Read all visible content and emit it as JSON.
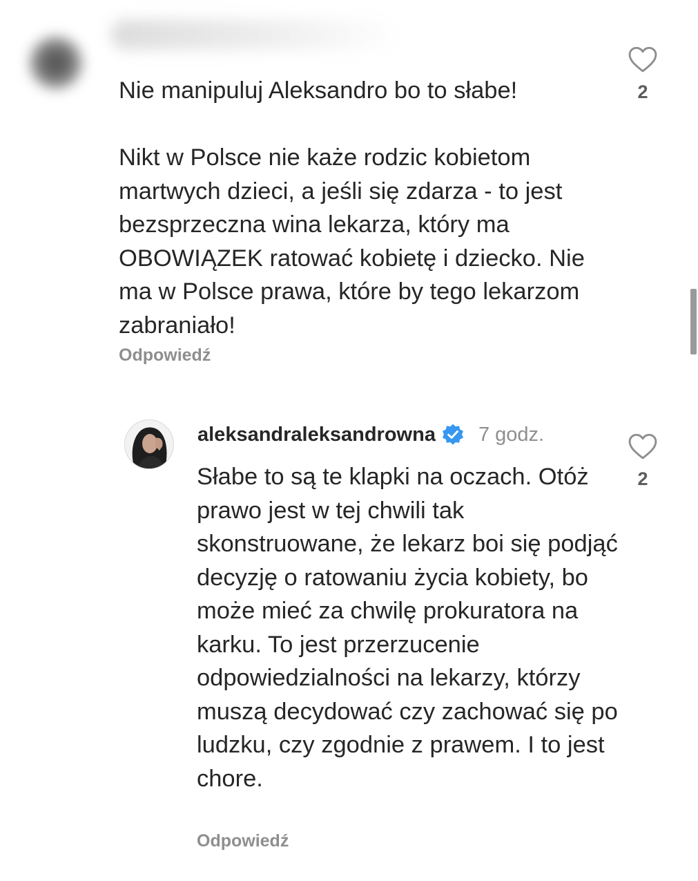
{
  "comments": [
    {
      "author": "",
      "text": "Nie manipuluj Aleksandro bo to słabe!\n\nNikt w Polsce nie każe rodzic kobietom martwych dzieci, a jeśli się zdarza - to jest bezsprzeczna wina lekarza, który ma OBOWIĄZEK ratować kobietę i dziecko. Nie ma w Polsce prawa, które by tego lekarzom zabraniało!",
      "reply_label": "Odpowiedź",
      "likes": "2",
      "author_blurred": true
    },
    {
      "author": "aleksandraleksandrowna",
      "verified": true,
      "time": "7 godz.",
      "text": "Słabe to są te klapki na oczach. Otóż prawo jest w tej chwili tak skonstruowane, że lekarz boi się podjąć decyzję o ratowaniu życia kobiety, bo może mieć za chwilę prokuratora na karku. To jest przerzucenie odpowiedzialności na lekarzy, którzy muszą decydować czy zachować się po ludzku, czy zgodnie z prawem. I to jest chore.",
      "reply_label": "Odpowiedź",
      "likes": "2"
    }
  ],
  "icons": {
    "like": "heart-outline-icon",
    "verified": "verified-badge-icon"
  },
  "colors": {
    "text": "#262626",
    "secondary": "#8e8e8e",
    "verified": "#3797f0",
    "like_count": "#5c5c5c"
  }
}
